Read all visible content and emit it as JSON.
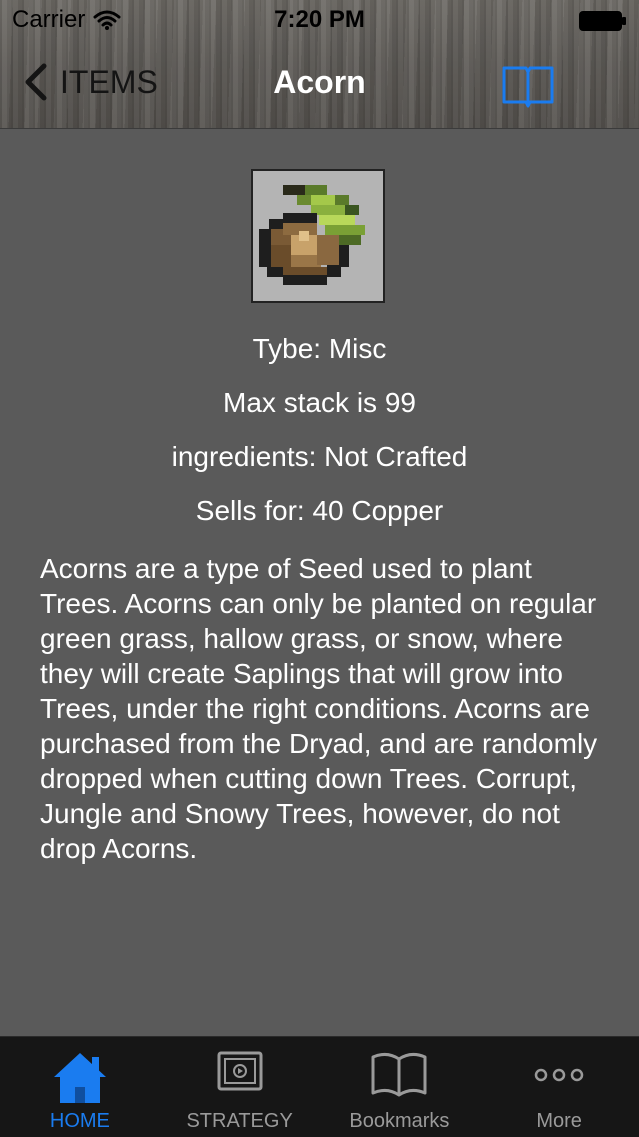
{
  "status_bar": {
    "carrier": "Carrier",
    "time": "7:20 PM"
  },
  "nav": {
    "back_label": "ITEMS",
    "title": "Acorn",
    "bookmark_icon": "open-book-icon"
  },
  "item": {
    "image_icon": "acorn-icon",
    "type": "Tybe: Misc",
    "max_stack": "Max stack is 99",
    "ingredients": "ingredients: Not Crafted",
    "sells_for": "Sells for: 40 Copper",
    "description": "Acorns are a type of Seed used to plant Trees. Acorns can only be planted on regular green grass, hallow grass, or snow, where they will create Saplings that will grow into Trees, under the right conditions. Acorns are purchased from the Dryad, and are randomly dropped when cutting down Trees. Corrupt, Jungle and Snowy Trees, however, do not drop Acorns."
  },
  "tabs": [
    {
      "label": "HOME",
      "icon": "home-icon",
      "active": true
    },
    {
      "label": "STRATEGY",
      "icon": "video-icon",
      "active": false
    },
    {
      "label": "Bookmarks",
      "icon": "open-book-icon",
      "active": false
    },
    {
      "label": "More",
      "icon": "more-icon",
      "active": false
    }
  ],
  "colors": {
    "accent": "#1a7cf0",
    "background": "#5a5a5a",
    "tab_bar": "#161616"
  }
}
